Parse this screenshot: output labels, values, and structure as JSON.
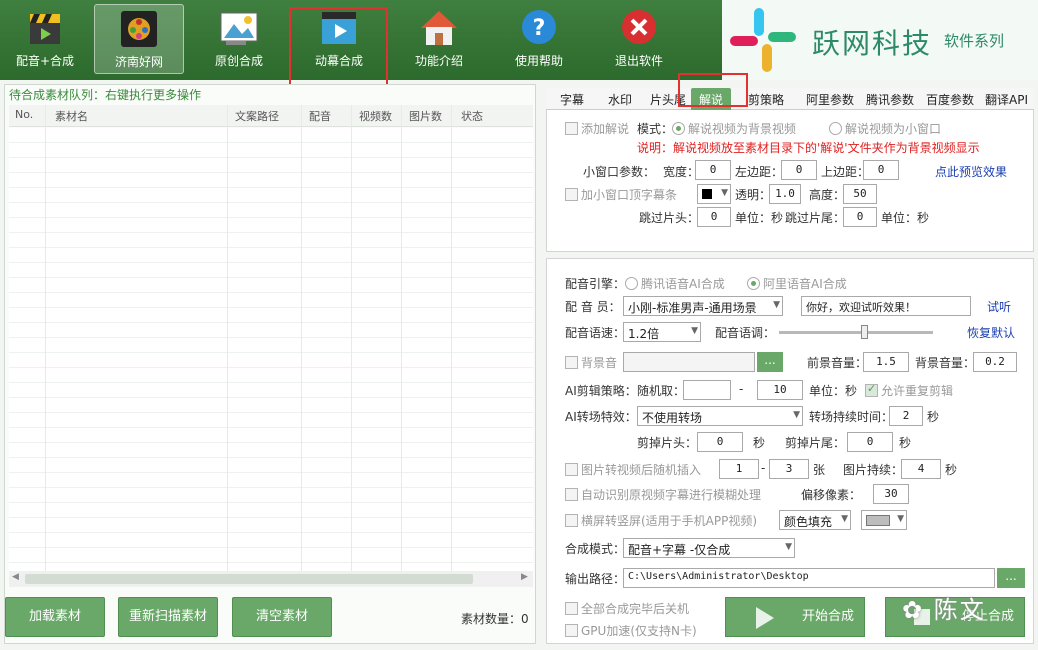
{
  "toolbar": [
    {
      "key": "dub",
      "label": "配音+合成",
      "icon": "clapper-icon"
    },
    {
      "key": "jinan",
      "label": "济南好网",
      "icon": "film-reel-icon"
    },
    {
      "key": "original",
      "label": "原创合成",
      "icon": "image-edit-icon"
    },
    {
      "key": "anim",
      "label": "动幕合成",
      "icon": "play-clapper-icon"
    },
    {
      "key": "intro",
      "label": "功能介绍",
      "icon": "house-icon"
    },
    {
      "key": "help",
      "label": "使用帮助",
      "icon": "question-icon"
    },
    {
      "key": "exit",
      "label": "退出软件",
      "icon": "close-circle-icon"
    }
  ],
  "brand": {
    "name": "跃网科技",
    "sub": "软件系列"
  },
  "queue": {
    "title": "待合成素材队列：右键执行更多操作",
    "headers": [
      "No.",
      "素材名",
      "文案路径",
      "配音",
      "视频数",
      "图片数",
      "状态"
    ],
    "buttons": [
      "加载素材",
      "重新扫描素材",
      "清空素材"
    ],
    "count_label": "素材数量：0"
  },
  "tabs": [
    "字幕",
    "水印",
    "片头尾",
    "解说",
    "剪策略",
    "阿里参数",
    "腾讯参数",
    "百度参数",
    "翻译API"
  ],
  "commentary": {
    "add_label": "添加解说",
    "mode_label": "模式：",
    "mode_bg": "解说视频为背景视频",
    "mode_small": "解说视频为小窗口",
    "note": "说明：解说视频放至素材目录下的'解说'文件夹作为背景视频显示",
    "smallwin_label": "小窗口参数：",
    "width_label": "宽度：",
    "width_val": "0",
    "leftm_label": "左边距：",
    "leftm_val": "0",
    "topm_label": "上边距：",
    "topm_val": "0",
    "preview_link": "点此预览效果",
    "topbar_label": "加小窗口顶字幕条",
    "alpha_label": "透明：",
    "alpha_val": "1.0",
    "height_label": "高度：",
    "height_val": "50",
    "skiphead_label": "跳过片头：",
    "skiphead_val": "0",
    "unit_sec": "单位：秒",
    "skiptail_label": "跳过片尾：",
    "skiptail_val": "0"
  },
  "dubbing": {
    "engine_label": "配音引擎：",
    "engine_tx": "腾讯语音AI合成",
    "engine_ali": "阿里语音AI合成",
    "voice_label": "配 音 员：",
    "voice_val": "小刚-标准男声-通用场景",
    "test_text": "你好，欢迎试听效果！",
    "listen_link": "试听",
    "speed_label": "配音语速：",
    "speed_val": "1.2倍",
    "pitch_label": "配音语调：",
    "pitch_level": 0.55,
    "reset_link": "恢复默认",
    "bgm_label": "背景音",
    "browse": "...",
    "front_vol_label": "前景音量：",
    "front_vol": "1.5",
    "bg_vol_label": "背景音量：",
    "bg_vol": "0.2",
    "cut_label": "AI剪辑策略：",
    "random_label": "随机取：",
    "random_from": "",
    "dash": "-",
    "random_to": "10",
    "unit_sec2": "单位：秒",
    "allow_repeat": "允许重复剪辑",
    "trans_label": "AI转场特效：",
    "trans_val": "不使用转场",
    "trans_dur_label": "转场持续时间：",
    "trans_dur": "2",
    "sec": "秒",
    "cuthead_label": "剪掉片头：",
    "cuthead": "0",
    "cuttail_label": "剪掉片尾：",
    "cuttail": "0",
    "img_insert_label": "图片转视频后随机插入",
    "img_from": "1",
    "img_to": "3",
    "img_unit": "张",
    "img_dur_label": "图片持续：",
    "img_dur": "4",
    "blur_label": "自动识别原视频字幕进行模糊处理",
    "offset_label": "偏移像素：",
    "offset": "30",
    "portrait_label": "横屏转竖屏(适用于手机APP视频)",
    "fill_val": "颜色填充",
    "compose_label": "合成模式：",
    "compose_val": "配音+字幕 -仅合成",
    "out_label": "输出路径：",
    "out_val": "C:\\Users\\Administrator\\Desktop",
    "shutdown_label": "全部合成完毕后关机",
    "gpu_label": "GPU加速(仅支持N卡)",
    "start": "开始合成",
    "stop": "停止合成"
  },
  "watermark": "陈文",
  "colors": {
    "accent": "#6aa86a",
    "toolbar": "#2d6a2d",
    "highlight": "#e53030"
  }
}
